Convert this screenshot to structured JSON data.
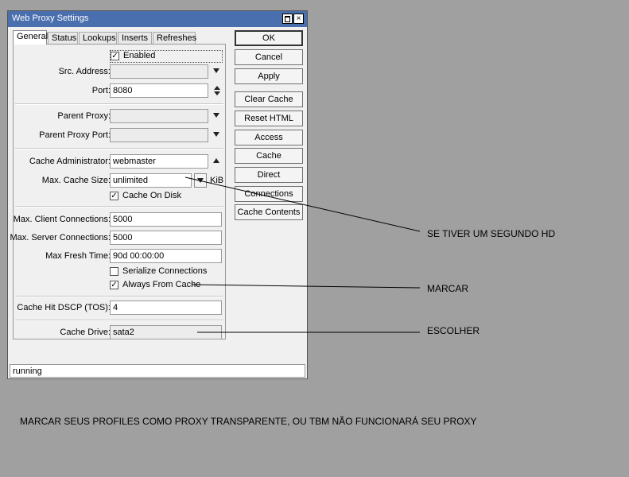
{
  "window": {
    "title": "Web Proxy Settings",
    "close_glyph": "×"
  },
  "tabs": [
    "General",
    "Status",
    "Lookups",
    "Inserts",
    "Refreshes"
  ],
  "general": {
    "enabled": {
      "label": "Enabled",
      "checked": true
    },
    "src_address": {
      "label": "Src. Address:",
      "value": ""
    },
    "port": {
      "label": "Port:",
      "value": "8080"
    },
    "parent_proxy": {
      "label": "Parent Proxy:",
      "value": ""
    },
    "parent_proxy_port": {
      "label": "Parent Proxy Port:",
      "value": ""
    },
    "cache_admin": {
      "label": "Cache Administrator:",
      "value": "webmaster"
    },
    "max_cache_size": {
      "label": "Max. Cache Size:",
      "value": "unlimited",
      "unit": "KiB"
    },
    "cache_on_disk": {
      "label": "Cache On Disk",
      "checked": true
    },
    "max_client_conn": {
      "label": "Max. Client Connections:",
      "value": "5000"
    },
    "max_server_conn": {
      "label": "Max. Server Connections:",
      "value": "5000"
    },
    "max_fresh_time": {
      "label": "Max Fresh Time:",
      "value": "90d 00:00:00"
    },
    "serialize_conn": {
      "label": "Serialize Connections",
      "checked": false
    },
    "always_from_cache": {
      "label": "Always From Cache",
      "checked": true
    },
    "cache_hit_dscp": {
      "label": "Cache Hit DSCP (TOS):",
      "value": "4"
    },
    "cache_drive": {
      "label": "Cache Drive:",
      "value": "sata2"
    }
  },
  "buttons": [
    "OK",
    "Cancel",
    "Apply",
    "Clear Cache",
    "Reset HTML",
    "Access",
    "Cache",
    "Direct",
    "Connections",
    "Cache Contents"
  ],
  "status": "running",
  "annotations": {
    "second_hd": "SE TIVER UM SEGUNDO HD",
    "marcar": "MARCAR",
    "escolher": "ESCOLHER",
    "footer": "MARCAR SEUS PROFILES COMO PROXY TRANSPARENTE, OU TBM NÃO FUNCIONARÁ SEU PROXY"
  },
  "colors": {
    "titlebar": "#4a6fae",
    "background": "#a0a0a0",
    "dialog": "#f0f0f0"
  }
}
